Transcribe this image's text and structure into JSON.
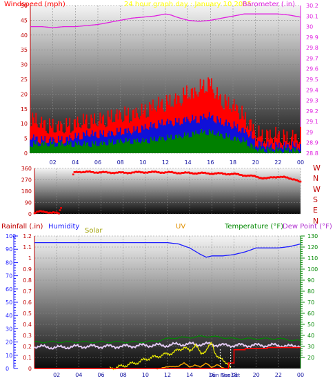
{
  "title": "24 hour graph day : January 10 2005",
  "colors": {
    "background": "#ffffff",
    "grid": "#8a8a8a",
    "wind_speed": "#ff0000",
    "wind_avg": "#1010d8",
    "wind_low": "#008000",
    "barometer": "#e020e0",
    "direction": "#ff0000",
    "humidity": "#1a1aff",
    "temperature": "#008800",
    "dew_point": "#b030d0",
    "uv": "#f0a000",
    "solar": "#f0f000",
    "rainfall": "#ff0000",
    "title": "#ffff00"
  },
  "chart_data": [
    {
      "type": "line",
      "title": "24 hour graph day : January 10 2005",
      "ylabel": "Windspeed (mph)",
      "y2label": "Barometer (.in)",
      "x_ticks": [
        "02",
        "04",
        "06",
        "08",
        "10",
        "12",
        "14",
        "16",
        "18",
        "20",
        "22",
        "00"
      ],
      "ylim": [
        0,
        50
      ],
      "yticks": [
        "0",
        "5",
        "10",
        "15",
        "20",
        "25",
        "30",
        "35",
        "40",
        "45",
        "50"
      ],
      "y2lim": [
        28.8,
        30.2
      ],
      "y2ticks": [
        "28.8",
        "28.9",
        "29",
        "29.1",
        "29.2",
        "29.3",
        "29.4",
        "29.5",
        "29.6",
        "29.7",
        "29.8",
        "29.9",
        "30",
        "30.1",
        "30.2"
      ],
      "grid": true,
      "series": [
        {
          "name": "Windspeed",
          "axis": "left",
          "x": [
            0,
            1,
            2,
            3,
            4,
            5,
            6,
            7,
            8,
            9,
            10,
            11,
            12,
            13,
            13.5,
            14,
            14.5,
            15,
            15.5,
            16,
            16.5,
            17,
            17.5,
            18,
            18.5,
            19,
            19.5,
            20,
            20.5,
            21,
            22,
            23,
            24
          ],
          "y": [
            9,
            7,
            6,
            6,
            7,
            8,
            8,
            9,
            10,
            10,
            11,
            13,
            14,
            15,
            16,
            18,
            17,
            19,
            20,
            21,
            17,
            15,
            14,
            13,
            12,
            9,
            7,
            4,
            3,
            3,
            3,
            2,
            3
          ]
        },
        {
          "name": "Wind average",
          "axis": "left",
          "x": [
            0,
            1,
            2,
            3,
            4,
            5,
            6,
            7,
            8,
            9,
            10,
            11,
            12,
            13,
            14,
            15,
            15.5,
            16,
            16.5,
            17,
            18,
            19,
            19.5,
            20,
            21,
            22,
            23,
            24
          ],
          "y": [
            4,
            3,
            3,
            3,
            4,
            5,
            5,
            5,
            6,
            6,
            7,
            8,
            9,
            9,
            10,
            10,
            11,
            11,
            10,
            9,
            8,
            6,
            5,
            2,
            1,
            1,
            1,
            1
          ]
        },
        {
          "name": "Wind low",
          "axis": "left",
          "x": [
            0,
            2,
            4,
            6,
            8,
            10,
            12,
            14,
            15,
            16,
            17,
            18,
            19,
            20,
            21,
            22,
            24
          ],
          "y": [
            2,
            2,
            2,
            2,
            3,
            3,
            4,
            5,
            6,
            6,
            5,
            4,
            3,
            0.5,
            0,
            0,
            0
          ]
        },
        {
          "name": "Barometer",
          "axis": "right",
          "x": [
            0,
            1,
            2,
            3,
            4,
            5,
            6,
            7,
            8,
            9,
            10,
            11,
            12,
            12.5,
            13,
            14,
            15,
            16,
            17,
            18,
            19,
            20,
            21,
            22,
            23,
            24
          ],
          "y": [
            30.0,
            30.0,
            29.99,
            30.0,
            30.0,
            30.01,
            30.02,
            30.04,
            30.06,
            30.08,
            30.09,
            30.1,
            30.12,
            30.11,
            30.09,
            30.06,
            30.05,
            30.06,
            30.08,
            30.1,
            30.12,
            30.12,
            30.12,
            30.12,
            30.11,
            30.09
          ]
        }
      ]
    },
    {
      "type": "scatter",
      "title": "",
      "ylabel": "",
      "x_ticks": [],
      "ylim": [
        0,
        360
      ],
      "yticks": [
        "0",
        "90",
        "180",
        "270",
        "360"
      ],
      "compass_labels": [
        "W",
        "N",
        "W",
        "S",
        "E",
        "N"
      ],
      "grid": true,
      "series": [
        {
          "name": "Wind direction",
          "x": [
            0,
            0.3,
            0.6,
            1,
            1.4,
            1.8,
            2.2,
            3.6,
            4,
            4.5,
            5,
            5.5,
            6,
            7,
            8,
            9,
            10,
            11,
            12,
            13,
            14,
            15,
            16,
            17,
            18,
            19,
            19.5,
            20,
            20.5,
            21,
            21.5,
            22,
            22.5,
            23,
            23.5,
            24
          ],
          "y": [
            5,
            15,
            20,
            18,
            10,
            8,
            5,
            330,
            335,
            330,
            332,
            330,
            328,
            327,
            325,
            328,
            330,
            330,
            328,
            325,
            323,
            322,
            320,
            318,
            315,
            305,
            300,
            295,
            285,
            280,
            290,
            295,
            290,
            280,
            275,
            250
          ]
        }
      ]
    },
    {
      "type": "line",
      "title": "",
      "labels": [
        "Rainfall (.in)",
        "Humidity",
        "Solar",
        "UV",
        "Temperature (°F)",
        "Dew Point (°F)"
      ],
      "x_ticks": [
        "02",
        "04",
        "06",
        "08",
        "10",
        "12",
        "14",
        "16",
        "18",
        "20",
        "22",
        "00"
      ],
      "special_x_labels": [
        {
          "x": 16.75,
          "label": "Sun Rise"
        },
        {
          "x": 17.7,
          "label": "Sun Set"
        }
      ],
      "ylim": [
        0,
        100
      ],
      "yticks": [
        "0",
        "10",
        "20",
        "30",
        "40",
        "50",
        "60",
        "70",
        "80",
        "90",
        "100"
      ],
      "rain_lim": [
        0,
        1.2
      ],
      "rain_ticks": [
        "0",
        "0.1",
        "0.2",
        "0.3",
        "0.4",
        "0.5",
        "0.6",
        "0.7",
        "0.8",
        "0.9",
        "1",
        "1.1",
        "1.2"
      ],
      "temp_lim": [
        10,
        130
      ],
      "temp_ticks": [
        "20",
        "30",
        "40",
        "50",
        "60",
        "70",
        "80",
        "90",
        "100",
        "110",
        "120",
        "130"
      ],
      "grid": true,
      "series": [
        {
          "name": "Humidity",
          "x": [
            0,
            2,
            4,
            6,
            8,
            10,
            12,
            13,
            14,
            15,
            15.5,
            16,
            17,
            18,
            19,
            20,
            21,
            22,
            23,
            24
          ],
          "y": [
            95,
            95,
            95,
            95,
            95,
            95,
            95,
            94,
            91,
            86,
            84,
            85,
            85,
            86,
            88,
            91,
            91,
            91,
            92,
            94
          ]
        },
        {
          "name": "Temperature",
          "x": [
            0,
            2,
            4,
            6,
            8,
            10,
            11,
            12,
            13,
            14,
            15,
            16,
            17,
            18,
            19,
            20,
            21,
            22,
            23,
            24
          ],
          "y": [
            34,
            34,
            34,
            34,
            34,
            34,
            35,
            37,
            38,
            38,
            39,
            39,
            38,
            37,
            37,
            37,
            37,
            37,
            36,
            35
          ]
        },
        {
          "name": "Dew Point",
          "x": [
            0,
            2,
            4,
            6,
            8,
            10,
            12,
            13,
            14,
            15,
            16,
            17,
            18,
            19,
            20,
            21,
            22,
            23,
            24
          ],
          "y": [
            30,
            29,
            30,
            30,
            30,
            31,
            31,
            32,
            32,
            32,
            32,
            31,
            31,
            31,
            31,
            31,
            31,
            30,
            31
          ]
        },
        {
          "name": "Solar",
          "x": [
            6.8,
            7.5,
            8.5,
            9.5,
            10,
            10.5,
            11,
            11.5,
            12,
            12.5,
            13,
            13.5,
            14,
            14.5,
            15,
            15.5,
            16,
            16.3,
            16.6,
            17,
            17.5,
            17.7
          ],
          "y": [
            0,
            1,
            3,
            5,
            7,
            8,
            9,
            10,
            11,
            12,
            14,
            16,
            13,
            18,
            11,
            14,
            19,
            12,
            8,
            6,
            4,
            0
          ]
        },
        {
          "name": "UV",
          "x": [
            11,
            12,
            13,
            13.5,
            14,
            14.5,
            15,
            15.5,
            16,
            16.5,
            17,
            17.5
          ],
          "y": [
            0,
            1,
            2,
            4,
            1,
            3,
            1,
            4,
            1,
            3,
            0,
            0
          ]
        },
        {
          "name": "Rainfall",
          "x": [
            0,
            16.8,
            17.5,
            18,
            19,
            20,
            21,
            22,
            23,
            24
          ],
          "y": [
            0,
            0,
            0.05,
            0.17,
            0.18,
            0.18,
            0.19,
            0.19,
            0.19,
            0.19
          ]
        }
      ]
    }
  ]
}
